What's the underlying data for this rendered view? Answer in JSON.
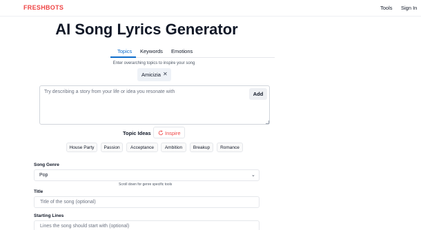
{
  "header": {
    "logo": "FRESHBOTS",
    "nav": {
      "tools": "Tools",
      "sign_in": "Sign In"
    }
  },
  "page": {
    "title": "AI Song Lyrics Generator"
  },
  "tabs": [
    {
      "label": "Topics",
      "active": true
    },
    {
      "label": "Keywords",
      "active": false
    },
    {
      "label": "Emotions",
      "active": false
    }
  ],
  "topics": {
    "hint": "Enter overarching topics to inspire your song",
    "chips": [
      {
        "label": "Amicizia",
        "remove_icon": "close-icon"
      }
    ],
    "textarea_placeholder": "Try describing a story from your life or idea you resonate with",
    "add_label": "Add"
  },
  "ideas": {
    "label": "Topic Ideas",
    "inspire_label": "Inspire",
    "inspire_icon": "refresh-icon",
    "items": [
      "House Party",
      "Passion",
      "Acceptance",
      "Ambition",
      "Breakup",
      "Romance"
    ]
  },
  "form": {
    "genre": {
      "label": "Song Genre",
      "value": "Pop",
      "note": "Scroll down for genre specific tools"
    },
    "title": {
      "label": "Title",
      "placeholder": "Title of the song (optional)"
    },
    "starting_lines": {
      "label": "Starting Lines",
      "placeholder": "Lines the song should start with (optional)"
    }
  },
  "colors": {
    "brand": "#ef4444",
    "accent": "#0b6bcb"
  }
}
